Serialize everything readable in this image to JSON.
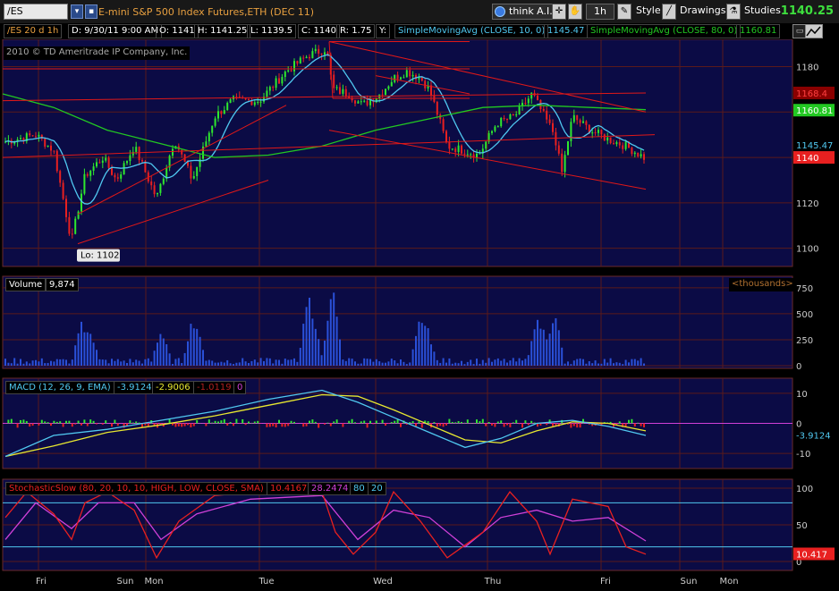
{
  "toolbar": {
    "symbol": "/ES",
    "description": "E-mini S&P 500 Index Futures,ETH (DEC 11)",
    "think_label": "think A.I.",
    "timeframe": "1h",
    "style_label": "Style",
    "drawings_label": "Drawings",
    "studies_label": "Studies",
    "last_price": "1140.25"
  },
  "info_bar": {
    "symbol_period": "/ES 20 d 1h",
    "date": "D: 9/30/11 9:00 AM",
    "open": "O: 1141",
    "high": "H: 1141.25",
    "low": "L: 1139.5",
    "close": "C: 1140",
    "range": "R: 1.75",
    "y": "Y:",
    "sma10_label": "SimpleMovingAvg (CLOSE, 10, 0)",
    "sma10_value": "1145.47",
    "sma80_label": "SimpleMovingAvg (CLOSE, 80, 0)",
    "sma80_value": "1160.81"
  },
  "price_panel": {
    "copyright": "2010 © TD Ameritrade IP Company, Inc.",
    "low_label": "Lo: 1102",
    "axis_ticks": [
      "1180",
      "1160",
      "1140",
      "1120",
      "1100"
    ],
    "badges": {
      "red": "1168.4",
      "green": "1160.81",
      "cyan": "1145.47",
      "last": "1140"
    }
  },
  "volume_panel": {
    "label": "Volume",
    "value": "9,874",
    "units": "<thousands>",
    "axis_ticks": [
      "750",
      "500",
      "250",
      "0"
    ]
  },
  "macd_panel": {
    "label": "MACD (12, 26, 9, EMA)",
    "value": "-3.9124",
    "avg": "-2.9006",
    "diff": "-1.0119",
    "zero": "0",
    "axis_ticks": [
      "10",
      "0",
      "-10"
    ],
    "badge": "-3.9124"
  },
  "stoch_panel": {
    "label": "StochasticSlow (80, 20, 10, 10, HIGH, LOW, CLOSE, SMA)",
    "k_value": "10.4167",
    "d_value": "28.2474",
    "over_bought": "80",
    "over_sold": "20",
    "axis_ticks": [
      "100",
      "50",
      "0"
    ],
    "badge": "10.417"
  },
  "x_axis": {
    "labels": [
      "Fri",
      "Sun",
      "Mon",
      "Tue",
      "Wed",
      "Thu",
      "Fri",
      "Sun",
      "Mon"
    ]
  },
  "colors": {
    "panel_bg": "#0b0b45",
    "grid": "#5a1a1a",
    "up": "#2ee82e",
    "down": "#e82020",
    "sma10": "#50c8f0",
    "sma80": "#22c822",
    "trendline": "#e01818",
    "volume": "#2a50d8",
    "macd_value": "#50c8f0",
    "macd_avg": "#e8e830",
    "stoch_k": "#e82020",
    "stoch_d": "#d040d8",
    "last_price": "#3ee03e"
  }
}
